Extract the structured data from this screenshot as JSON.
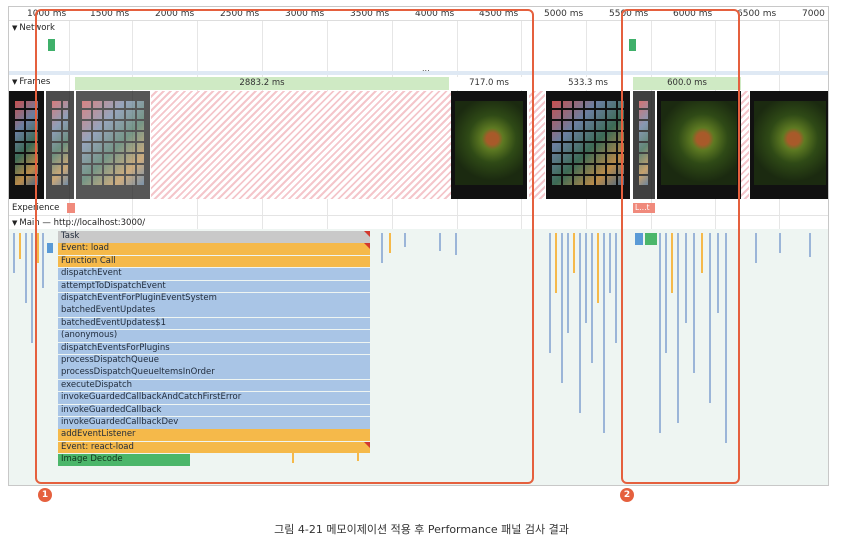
{
  "ruler": {
    "ticks": [
      {
        "label": "1000 ms"
      },
      {
        "label": "1500 ms"
      },
      {
        "label": "2000 ms"
      },
      {
        "label": "2500 ms"
      },
      {
        "label": "3000 ms"
      },
      {
        "label": "3500 ms"
      },
      {
        "label": "4000 ms"
      },
      {
        "label": "4500 ms"
      },
      {
        "label": "5000 ms"
      },
      {
        "label": "5500 ms"
      },
      {
        "label": "6000 ms"
      },
      {
        "label": "6500 ms"
      },
      {
        "label": "7000"
      }
    ]
  },
  "tracks": {
    "network_label": "Network",
    "overflow": "...",
    "frames_label": "Frames",
    "experience_label": "Experience",
    "main_label": "Main — http://localhost:3000/"
  },
  "frames": {
    "durations": [
      "2883.2 ms",
      "717.0 ms",
      "533.3 ms",
      "600.0 ms"
    ]
  },
  "experience": {
    "bar_label": "L…t"
  },
  "call_stack": [
    {
      "label": "Task",
      "kind": "task",
      "flag": true
    },
    {
      "label": "Event: load",
      "kind": "orange",
      "flag": true
    },
    {
      "label": "Function Call",
      "kind": "orange",
      "flag": false
    },
    {
      "label": "dispatchEvent",
      "kind": "blue",
      "flag": false
    },
    {
      "label": "attemptToDispatchEvent",
      "kind": "blue",
      "flag": false
    },
    {
      "label": "dispatchEventForPluginEventSystem",
      "kind": "blue",
      "flag": false
    },
    {
      "label": "batchedEventUpdates",
      "kind": "blue",
      "flag": false
    },
    {
      "label": "batchedEventUpdates$1",
      "kind": "blue",
      "flag": false
    },
    {
      "label": "(anonymous)",
      "kind": "blue",
      "flag": false
    },
    {
      "label": "dispatchEventsForPlugins",
      "kind": "blue",
      "flag": false
    },
    {
      "label": "processDispatchQueue",
      "kind": "blue",
      "flag": false
    },
    {
      "label": "processDispatchQueueItemsInOrder",
      "kind": "blue",
      "flag": false
    },
    {
      "label": "executeDispatch",
      "kind": "blue",
      "flag": false
    },
    {
      "label": "invokeGuardedCallbackAndCatchFirstError",
      "kind": "blue",
      "flag": false
    },
    {
      "label": "invokeGuardedCallback",
      "kind": "blue",
      "flag": false
    },
    {
      "label": "invokeGuardedCallbackDev",
      "kind": "blue",
      "flag": false
    },
    {
      "label": "addEventListener",
      "kind": "orange",
      "flag": false
    },
    {
      "label": "Event: react-load",
      "kind": "orange",
      "flag": true
    },
    {
      "label": "Image Decode",
      "kind": "green",
      "flag": false
    }
  ],
  "annotations": {
    "marker_1": "1",
    "marker_2": "2",
    "accent_color": "#e5603e"
  },
  "caption": "그림 4-21 메모이제이션 적용 후 Performance 패널 검사 결과"
}
